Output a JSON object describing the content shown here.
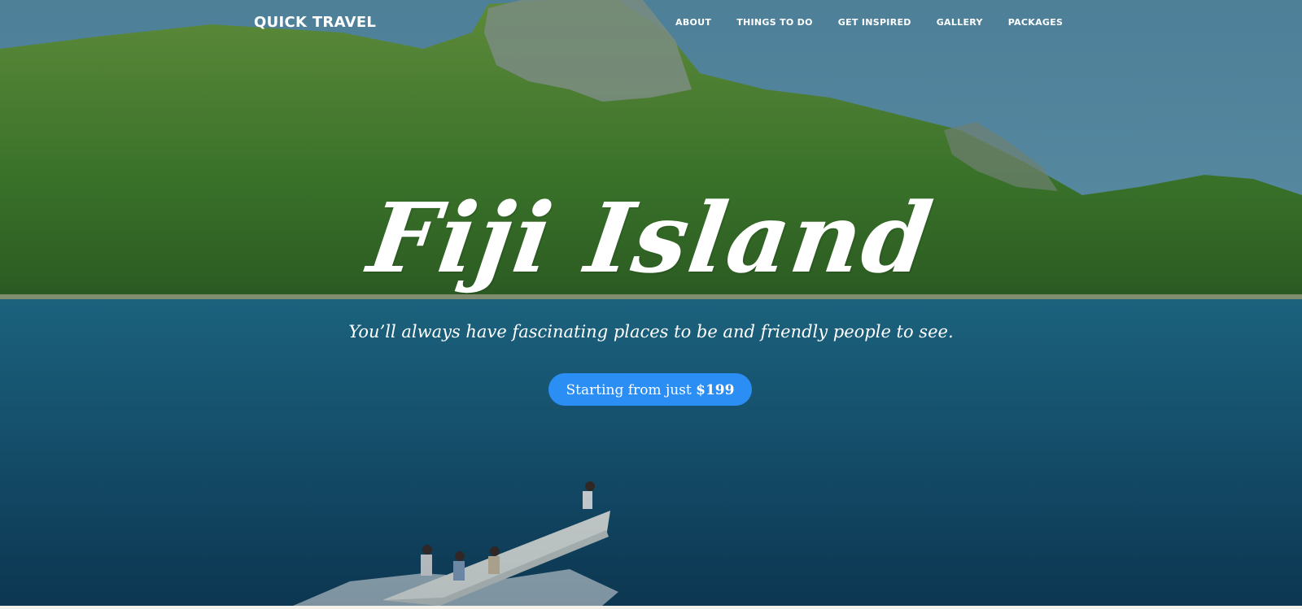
{
  "navbar": {
    "brand": "QUICK TRAVEL",
    "links": [
      "ABOUT",
      "THINGS TO DO",
      "GET INSPIRED",
      "GALLERY",
      "PACKAGES"
    ]
  },
  "hero": {
    "title": "Fiji Island",
    "subtitle": "You’ll always have fascinating places to be and friendly people to see.",
    "cta_prefix": "Starting from just ",
    "cta_price": "$199"
  },
  "colors": {
    "cta_background": "#2b8ef5",
    "text": "#ffffff",
    "sea": "#1b4f6b",
    "island": "#4f8a2c"
  }
}
